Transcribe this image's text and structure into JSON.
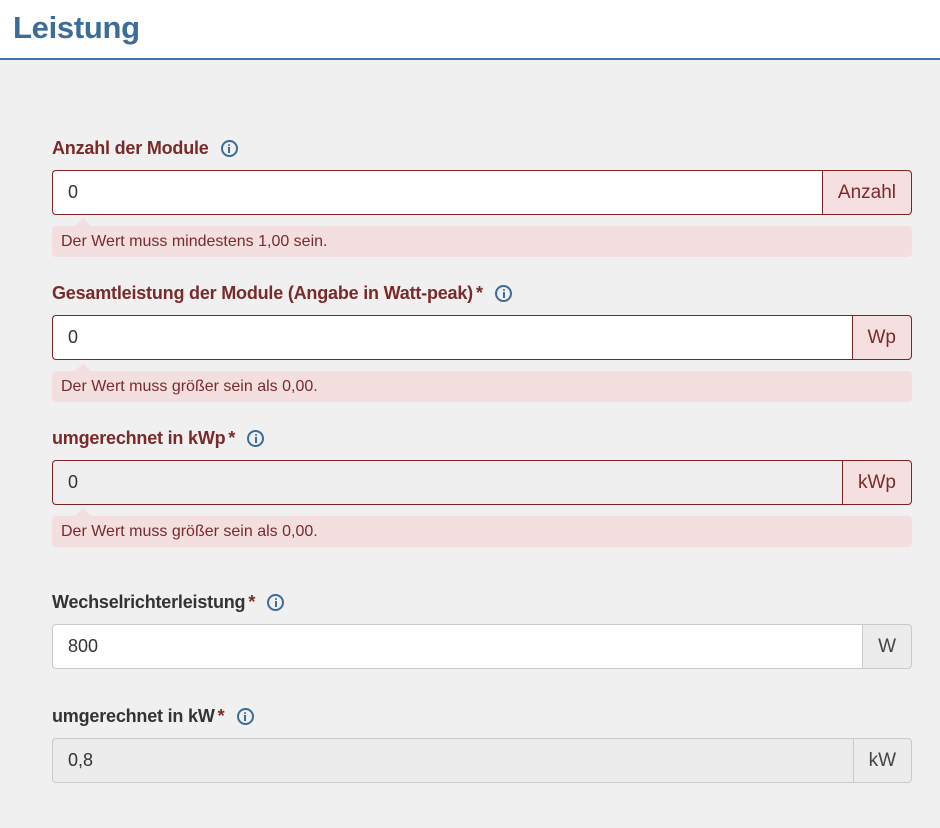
{
  "header": {
    "title": "Leistung"
  },
  "fields": [
    {
      "label": "Anzahl der Module",
      "required": "",
      "value": "0",
      "unit": "Anzahl",
      "error": "Der Wert muss mindestens 1,00 sein."
    },
    {
      "label": "Gesamtleistung der Module (Angabe in Watt-peak)",
      "required": "*",
      "value": "0",
      "unit": "Wp",
      "error": "Der Wert muss größer sein als 0,00."
    },
    {
      "label": "umgerechnet in kWp",
      "required": "*",
      "value": "0",
      "unit": "kWp",
      "error": "Der Wert muss größer sein als 0,00."
    },
    {
      "label": "Wechselrichterleistung",
      "required": "*",
      "value": "800",
      "unit": "W"
    },
    {
      "label": "umgerechnet in kW",
      "required": "*",
      "value": "0,8",
      "unit": "kW"
    }
  ],
  "colors": {
    "accent": "#3b6d98",
    "error": "#7a2a2a",
    "error_bg": "#f3dfe0",
    "background": "#eff0ef"
  },
  "icons": {
    "info": "info-circle-icon"
  }
}
